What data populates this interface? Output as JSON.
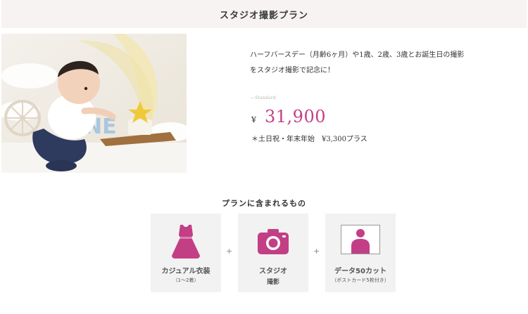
{
  "header": {
    "title": "スタジオ撮影プラン"
  },
  "description": {
    "line1": "ハーフバースデー（月齢6ヶ月）や1歳、2歳、3歳とお誕生日の撮影",
    "line2": "をスタジオ撮影で記念に！"
  },
  "plan": {
    "standard_label": "―Standard",
    "currency": "¥",
    "price": "31,900",
    "note": "＊土日祝・年末年始　¥3,300プラス"
  },
  "includes": {
    "title": "プランに含まれるもの",
    "plus": "+",
    "items": [
      {
        "icon": "dress-icon",
        "label": "カジュアル衣装",
        "sub": "（1〜2着）"
      },
      {
        "icon": "camera-icon",
        "label": "スタジオ",
        "sub": "撮影"
      },
      {
        "icon": "portrait-icon",
        "label": "データ50カット",
        "sub": "（ポストカード5枚付き）"
      }
    ]
  },
  "colors": {
    "accent": "#c23f86",
    "header_bg": "#f7f3f3",
    "card_bg": "#f2f2f2"
  }
}
